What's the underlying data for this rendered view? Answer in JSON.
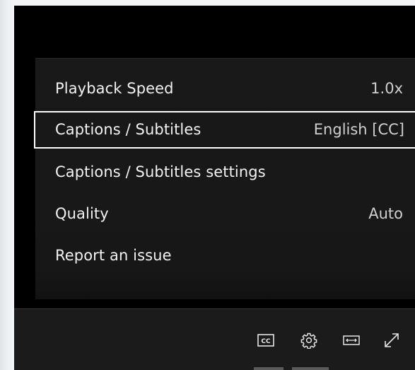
{
  "settings_menu": {
    "items": [
      {
        "label": "Playback Speed",
        "value": "1.0x"
      },
      {
        "label": "Captions / Subtitles",
        "value": "English [CC]"
      },
      {
        "label": "Captions / Subtitles settings",
        "value": ""
      },
      {
        "label": "Quality",
        "value": "Auto"
      },
      {
        "label": "Report an issue",
        "value": ""
      }
    ],
    "selected_index": 1
  },
  "controls": {
    "icons": [
      "closed-captions-icon",
      "gear-icon",
      "widescreen-icon",
      "fullscreen-icon"
    ]
  },
  "colors": {
    "player_background": "#000000",
    "menu_background": "#191919",
    "control_bar": "#1b1b1b",
    "selection_border": "#ffffff",
    "text": "#f2f2f2"
  }
}
